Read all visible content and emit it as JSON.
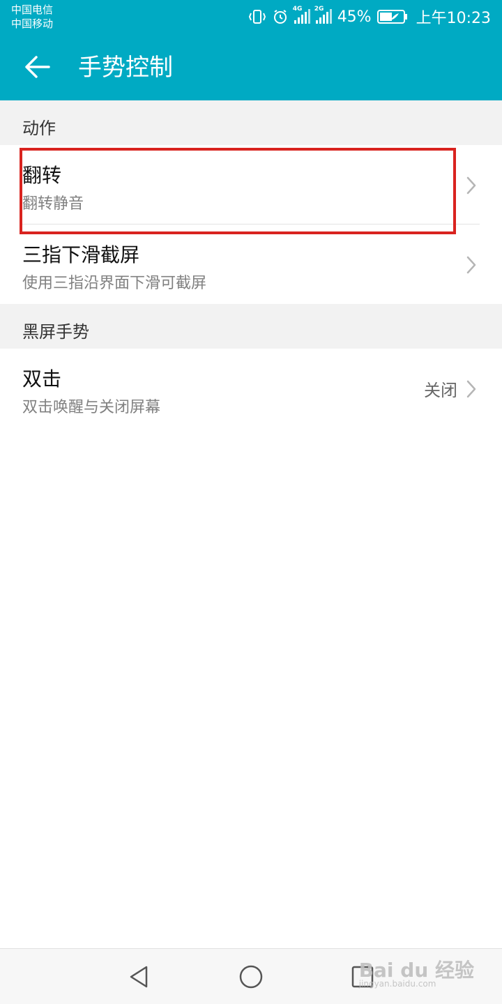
{
  "status_bar": {
    "carrier_1": "中国电信",
    "carrier_2": "中国移动",
    "signal_1_tag": "4G",
    "signal_2_tag": "2G",
    "battery_percent": "45%",
    "time": "上午10:23",
    "icons": [
      "vibrate-icon",
      "alarm-icon",
      "signal-icon",
      "battery-icon"
    ]
  },
  "app_bar": {
    "title": "手势控制",
    "back_icon": "back-arrow-icon"
  },
  "sections": [
    {
      "header": "动作",
      "items": [
        {
          "title": "翻转",
          "subtitle": "翻转静音",
          "value": ""
        },
        {
          "title": "三指下滑截屏",
          "subtitle": "使用三指沿界面下滑可截屏",
          "value": ""
        }
      ]
    },
    {
      "header": "黑屏手势",
      "items": [
        {
          "title": "双击",
          "subtitle": "双击唤醒与关闭屏幕",
          "value": "关闭"
        }
      ]
    }
  ],
  "nav_bar": {
    "icons": [
      "nav-back-icon",
      "nav-home-icon",
      "nav-recents-icon"
    ]
  },
  "watermark": {
    "text": "Bai du 经验",
    "subtext": "jingyan.baidu.com"
  },
  "colors": {
    "accent": "#00aac3",
    "highlight": "#d9231f"
  }
}
